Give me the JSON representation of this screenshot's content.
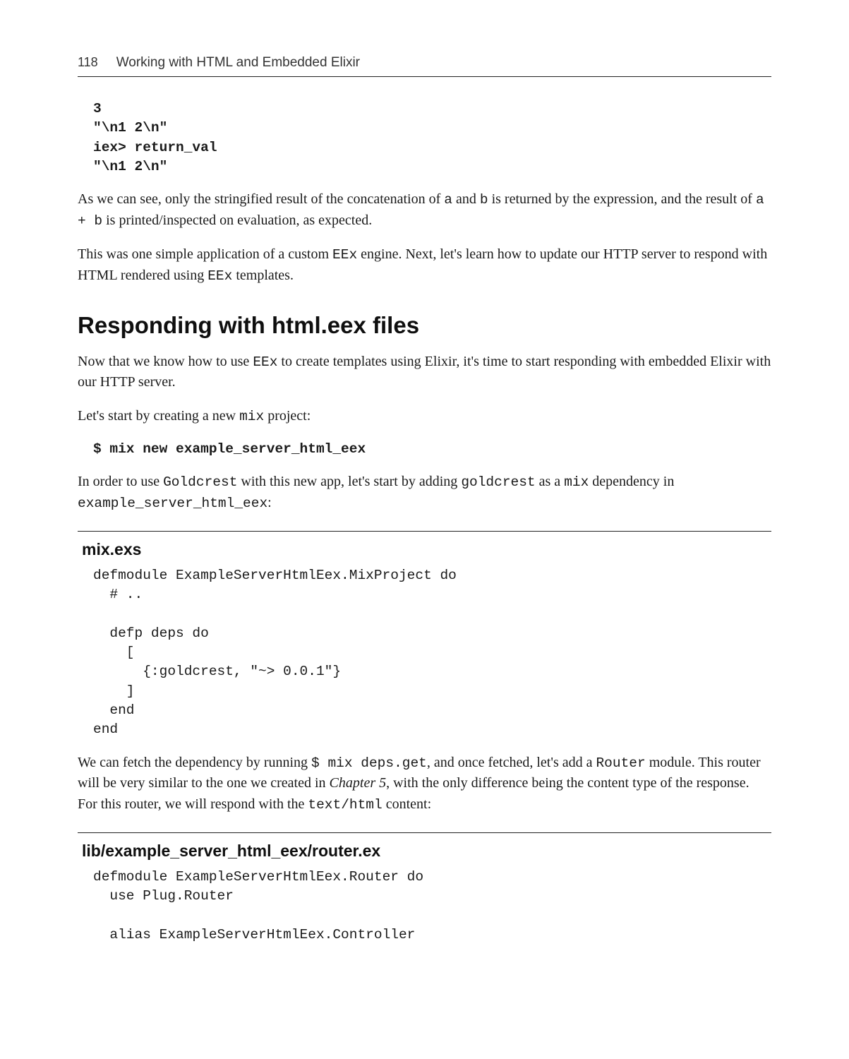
{
  "header": {
    "page_number": "118",
    "chapter": "Working with HTML and Embedded Elixir"
  },
  "code1": {
    "l1": "3",
    "l2": "\"\\n1 2\\n\"",
    "l3": "iex> return_val",
    "l4": "\"\\n1 2\\n\""
  },
  "para1": {
    "t1": "As we can see, only the stringified result of the concatenation of ",
    "c1": "a",
    "t2": " and ",
    "c2": "b",
    "t3": " is returned by the expression, and the result of ",
    "c3": "a + b",
    "t4": " is printed/inspected on evaluation, as expected."
  },
  "para2": {
    "t1": "This was one simple application of a custom ",
    "c1": "EEx",
    "t2": " engine. Next, let's learn how to update our HTTP server to respond with HTML rendered using ",
    "c2": "EEx",
    "t3": " templates."
  },
  "section_heading": "Responding with html.eex files",
  "para3": {
    "t1": "Now that we know how to use ",
    "c1": "EEx",
    "t2": " to create templates using Elixir, it's time to start responding with embedded Elixir with our HTTP server."
  },
  "para4": {
    "t1": "Let's start by creating a new ",
    "c1": "mix",
    "t2": " project:"
  },
  "code2": "$ mix new example_server_html_eex",
  "para5": {
    "t1": "In order to use ",
    "c1": "Goldcrest",
    "t2": " with this new app, let's start by adding ",
    "c2": "goldcrest",
    "t3": " as a ",
    "c3": "mix",
    "t4": " dependency in ",
    "c4": "example_server_html_eex",
    "t5": ":"
  },
  "file1": {
    "name": "mix.exs",
    "code": "defmodule ExampleServerHtmlEex.MixProject do\n  # ..\n\n  defp deps do\n    [\n      {:goldcrest, \"~> 0.0.1\"}\n    ]\n  end\nend"
  },
  "para6": {
    "t1": "We can fetch the dependency by running ",
    "c1": "$ mix deps.get",
    "t2": ", and once fetched, let's add a ",
    "c2": "Router",
    "t3": " module. This router will be very similar to the one we created in ",
    "i1": "Chapter 5",
    "t4": ", with the only difference being the content type of the response. For this router, we will respond with the ",
    "c3": "text/html",
    "t5": " content:"
  },
  "file2": {
    "name": "lib/example_server_html_eex/router.ex",
    "code": "defmodule ExampleServerHtmlEex.Router do\n  use Plug.Router\n\n  alias ExampleServerHtmlEex.Controller"
  }
}
